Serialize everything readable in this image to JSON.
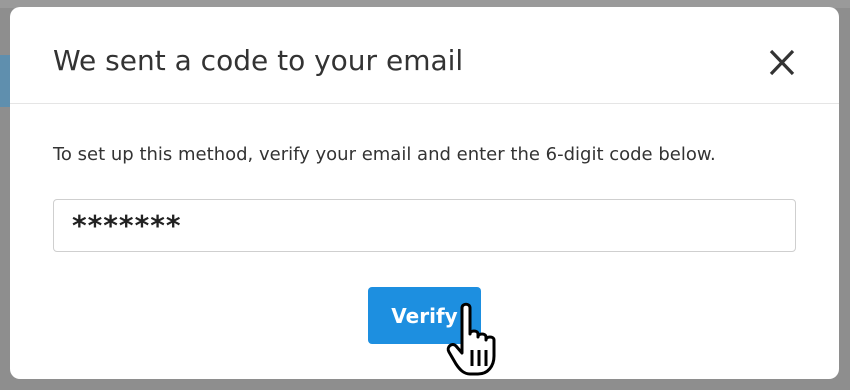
{
  "dialog": {
    "title": "We sent a code to your email",
    "close_icon": "close-x-icon",
    "instructions": "To set up this method, verify your email and enter the 6-digit code below.",
    "code_input_value": "*******",
    "verify_label": "Verify",
    "accent_color": "#1d8fe0"
  },
  "cursor": {
    "icon": "hand-pointer-icon"
  }
}
